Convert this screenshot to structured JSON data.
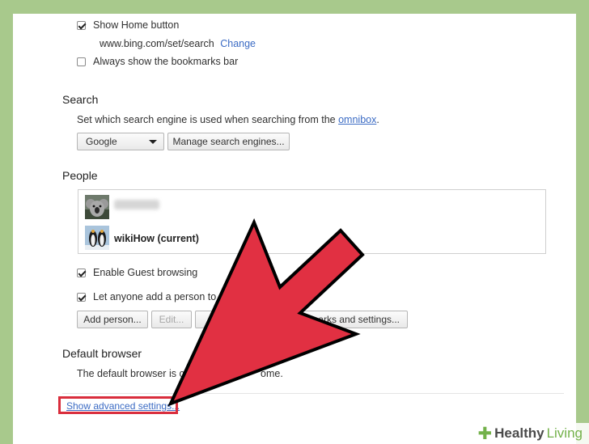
{
  "appearance": {
    "show_home_button": {
      "label": "Show Home button",
      "checked": true
    },
    "home_url": "www.bing.com/set/search",
    "change_link": "Change",
    "bookmarks_bar": {
      "label": "Always show the bookmarks bar",
      "checked": false
    }
  },
  "search": {
    "heading": "Search",
    "description_prefix": "Set which search engine is used when searching from the ",
    "omnibox_link": "omnibox",
    "description_suffix": ".",
    "engine_select": "Google",
    "manage_button": "Manage search engines..."
  },
  "people": {
    "heading": "People",
    "profiles": [
      {
        "name": ""
      },
      {
        "name": "wikiHow (current)"
      }
    ],
    "guest_browsing": {
      "label": "Enable Guest browsing",
      "checked": true
    },
    "anyone_add": {
      "label": "Let anyone add a person to C",
      "checked": true
    },
    "add_person_button": "Add person...",
    "edit_button": "Edit...",
    "import_button": "marks and settings..."
  },
  "default_browser": {
    "heading": "Default browser",
    "text_start": "The default browser is cu",
    "text_end": "ome."
  },
  "advanced_link": "Show advanced settings...",
  "watermark": {
    "brand": "Healthy",
    "brand_suffix": "Living"
  },
  "colors": {
    "arrow": "#e13042",
    "arrow_outline": "#000000",
    "link": "#3b6bc4",
    "background": "#a8c98c"
  }
}
